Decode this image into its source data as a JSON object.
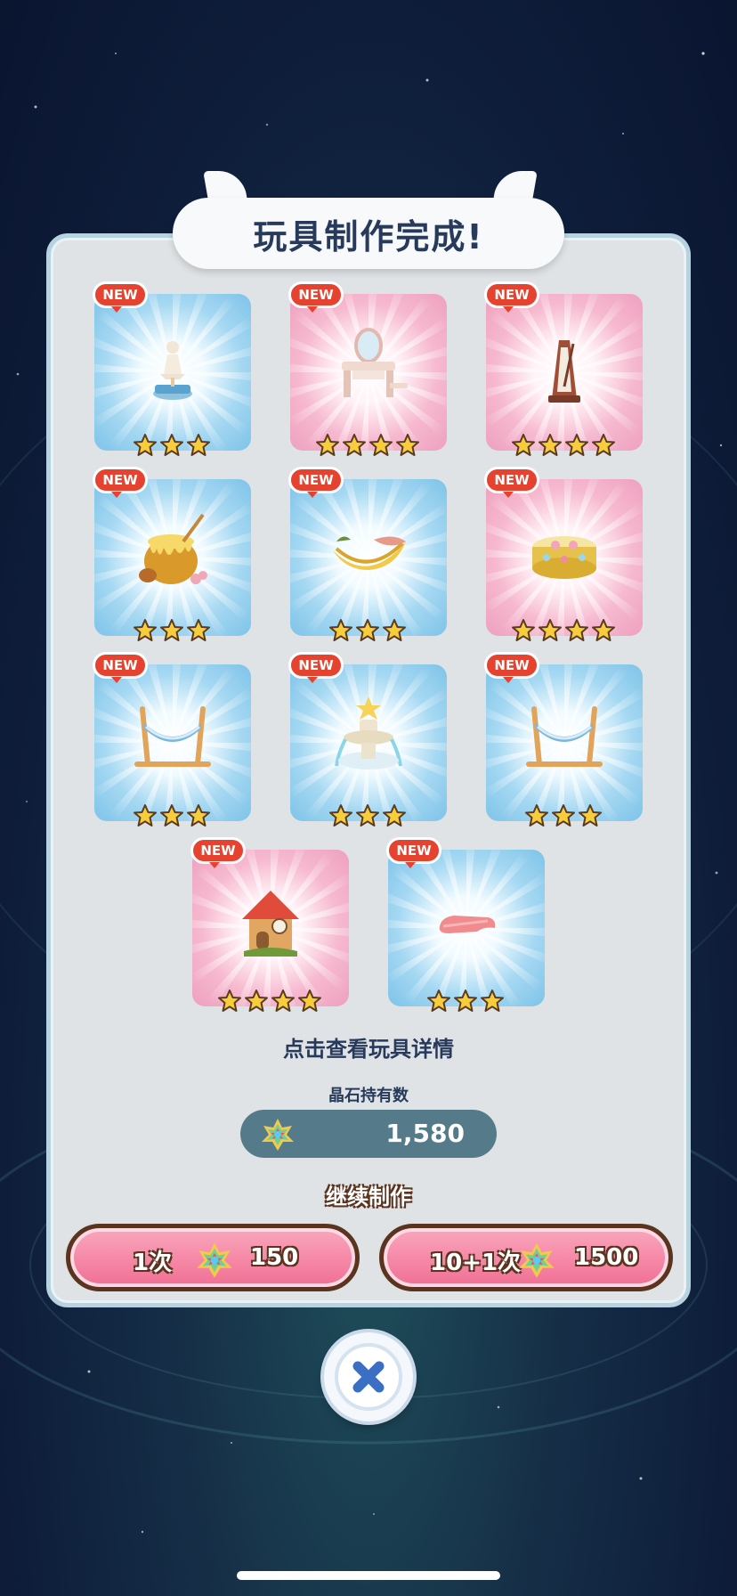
{
  "title": "玩具制作完成!",
  "new_label": "NEW",
  "items": [
    {
      "toy": "ballerina-music-box-icon",
      "glow": "blue",
      "stars": 3
    },
    {
      "toy": "vanity-table-icon",
      "glow": "pink",
      "stars": 4
    },
    {
      "toy": "metronome-icon",
      "glow": "pink",
      "stars": 4
    },
    {
      "toy": "honey-pot-icon",
      "glow": "blue",
      "stars": 3
    },
    {
      "toy": "banana-boat-icon",
      "glow": "blue",
      "stars": 3
    },
    {
      "toy": "jewel-box-icon",
      "glow": "pink",
      "stars": 4
    },
    {
      "toy": "hammock-icon",
      "glow": "blue",
      "stars": 3
    },
    {
      "toy": "fountain-icon",
      "glow": "blue",
      "stars": 3
    },
    {
      "toy": "hammock-icon",
      "glow": "blue",
      "stars": 3
    },
    {
      "toy": "cuckoo-house-icon",
      "glow": "pink",
      "stars": 4
    },
    {
      "toy": "pink-mat-icon",
      "glow": "blue",
      "stars": 3
    }
  ],
  "hint": "点击查看玩具详情",
  "crystal": {
    "label": "晶石持有数",
    "count": "1,580",
    "icon": "rainbow-crystal-icon"
  },
  "continue_label": "继续制作",
  "buttons": {
    "single": {
      "label": "1次",
      "cost": "150"
    },
    "multi": {
      "label": "10+1次",
      "cost": "1500"
    }
  },
  "close_icon": "close-icon",
  "colors": {
    "blue_glow": "#7ec3e8",
    "pink_glow": "#eea0be",
    "new_badge": "#e5432f",
    "button_pink": "#f68aa8",
    "button_border": "#5b3420",
    "title_text": "#273a5c",
    "close_x": "#3a6fc4"
  }
}
